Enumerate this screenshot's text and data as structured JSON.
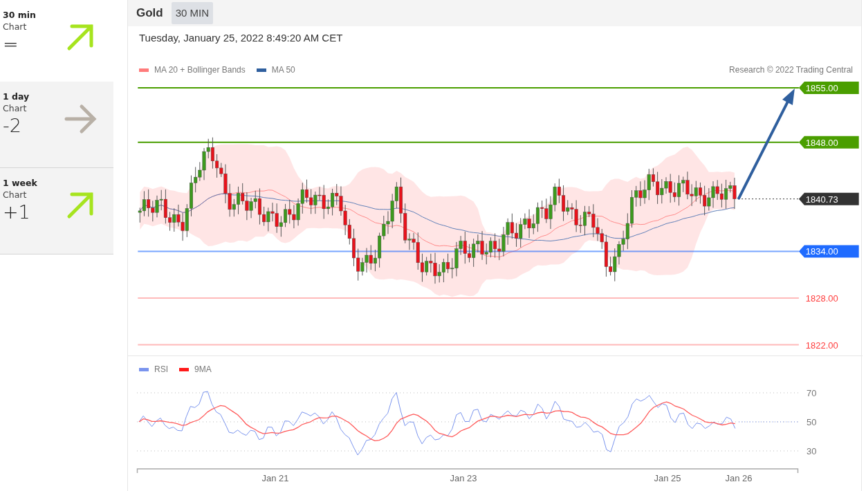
{
  "sidebar": [
    {
      "period": "30 min",
      "label": "Chart",
      "score": "=",
      "kind": "up",
      "selected": true
    },
    {
      "period": "1 day",
      "label": "Chart",
      "score": "-2",
      "kind": "flat",
      "selected": false
    },
    {
      "period": "1 week",
      "label": "Chart",
      "score": "+1",
      "kind": "up",
      "selected": false
    }
  ],
  "header": {
    "instrument": "Gold",
    "timeframe": "30 MIN"
  },
  "timestamp": "Tuesday, January 25, 2022 8:49:20 AM CET",
  "legend": [
    {
      "label": "MA 20 + Bollinger Bands",
      "color": "#ff7b7b"
    },
    {
      "label": "MA 50",
      "color": "#2f5f9e"
    }
  ],
  "credit": "Research © 2022 Trading Central",
  "levels": [
    {
      "label": "1855.00",
      "kind": "tag",
      "dotted": false,
      "color": "#4a9e00"
    },
    {
      "label": "1848.00",
      "kind": "tag",
      "dotted": false,
      "color": "#4a9e00"
    },
    {
      "label": "1840.73",
      "kind": "tag",
      "dotted": true,
      "color": "#333333"
    },
    {
      "label": "1834.00",
      "kind": "tag",
      "dotted": false,
      "color": "#1f6bff"
    },
    {
      "label": "1828.00",
      "kind": "plain",
      "dotted": false,
      "color": "#ff3b3b"
    },
    {
      "label": "1822.00",
      "kind": "plain",
      "dotted": false,
      "color": "#ff3b3b"
    }
  ],
  "rsi_legend": [
    {
      "label": "RSI",
      "color": "#7a94ee"
    },
    {
      "label": "9MA",
      "color": "#ff1a1a"
    }
  ],
  "rsi_ticks": [
    "70",
    "50",
    "30"
  ],
  "x_labels": [
    "Jan 21",
    "Jan 23",
    "Jan 25",
    "Jan 26"
  ]
}
